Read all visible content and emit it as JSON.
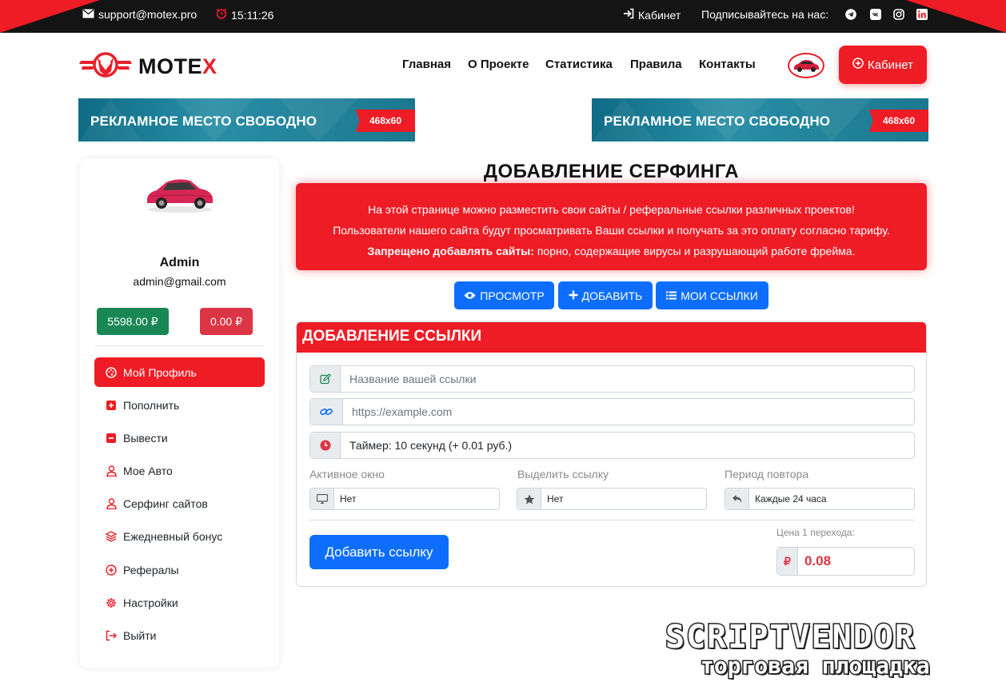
{
  "topbar": {
    "email": "support@motex.pro",
    "time": "15:11:26",
    "cabinet": "Кабинет",
    "subscribe": "Подписывайтесь на нас:",
    "socials": [
      "telegram-icon",
      "vk-icon",
      "instagram-icon",
      "linkedin-icon"
    ]
  },
  "header": {
    "logo_main": "MOTE",
    "logo_accent": "X",
    "nav": [
      "Главная",
      "О Проекте",
      "Статистика",
      "Правила",
      "Контакты"
    ],
    "cabinet_button": "Кабинет"
  },
  "banners": [
    {
      "text": "РЕКЛАМНОЕ  МЕСТО СВОБОДНО",
      "size": "468x60"
    },
    {
      "text": "РЕКЛАМНОЕ  МЕСТО СВОБОДНО",
      "size": "468x60"
    }
  ],
  "sidebar": {
    "name": "Admin",
    "email": "admin@gmail.com",
    "balance_main": "5598.00 ₽",
    "balance_ad": "0.00 ₽",
    "menu": [
      {
        "label": "Мой Профиль",
        "icon": "palette-icon",
        "active": true
      },
      {
        "label": "Пополнить",
        "icon": "plus-square-icon"
      },
      {
        "label": "Вывести",
        "icon": "minus-square-icon"
      },
      {
        "label": "Мое Авто",
        "icon": "user-icon"
      },
      {
        "label": "Серфинг сайтов",
        "icon": "user-icon"
      },
      {
        "label": "Ежедневный бонус",
        "icon": "layers-icon"
      },
      {
        "label": "Рефералы",
        "icon": "plus-circle-icon"
      },
      {
        "label": "Настройки",
        "icon": "gear-icon"
      },
      {
        "label": "Выйти",
        "icon": "logout-icon"
      }
    ]
  },
  "main": {
    "title": "ДОБАВЛЕНИЕ СЕРФИНГА",
    "alert_line1": "На этой странице можно разместить свои сайты / реферальные ссылки различных проектов!",
    "alert_line2": "Пользователи нашего сайта будут просматривать Ваши ссылки и получать за это оплату согласно тарифу.",
    "alert_bold": "Запрещено добавлять сайты:",
    "alert_line3": " порно, содержащие вирусы и разрушающий работе фрейма.",
    "buttons": {
      "view": "ПРОСМОТР",
      "add": "ДОБАВИТЬ",
      "my_links": "МОИ ССЫЛКИ"
    }
  },
  "form": {
    "card_title": "ДОБАВЛЕНИЕ ССЫЛКИ",
    "name_placeholder": "Название вашей ссылки",
    "url_placeholder": "https://example.com",
    "timer_value": "Таймер: 10 секунд (+ 0.01 руб.)",
    "active_window_label": "Активное окно",
    "active_window_value": "Нет",
    "highlight_label": "Выделить ссылку",
    "highlight_value": "Нет",
    "repeat_label": "Период повтора",
    "repeat_value": "Каждые 24 часа",
    "submit": "Добавить ссылку",
    "price_label": "Цена 1 перехода:",
    "price_currency": "₽",
    "price_value": "0.08"
  },
  "watermark": {
    "title": "SCRIPTVENDOR",
    "subtitle": "торговая площадка"
  },
  "colors": {
    "accent": "#ee1c25",
    "primary": "#0d6efd",
    "success": "#198754",
    "danger": "#dc3545",
    "topbar": "#141414"
  }
}
